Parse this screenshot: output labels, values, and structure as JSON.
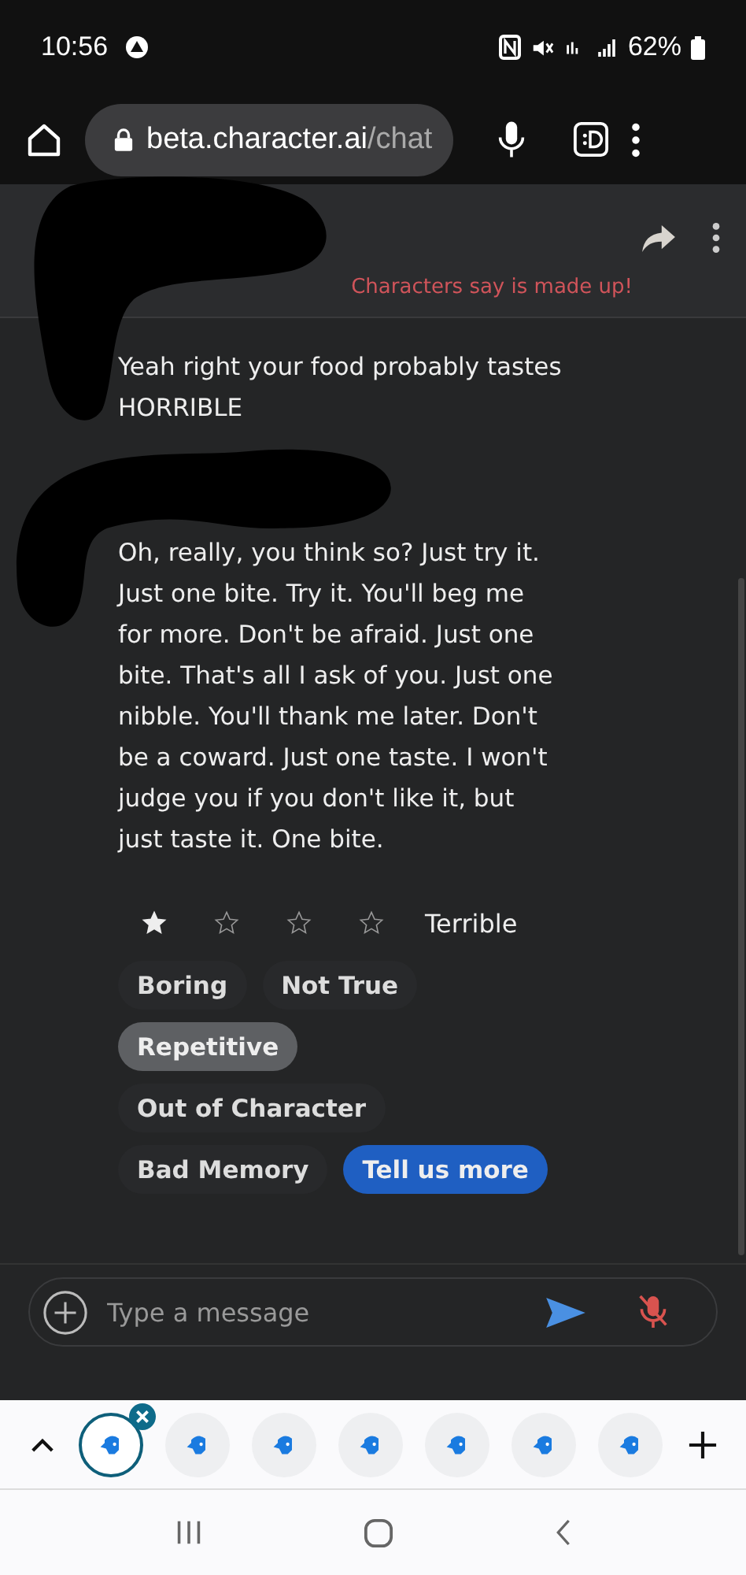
{
  "status_bar": {
    "time": "10:56",
    "battery": "62%"
  },
  "browser": {
    "url_host": "beta.character.ai",
    "url_path": "/chat"
  },
  "chat": {
    "notice": "Characters say is made up!",
    "messages": [
      {
        "text": "Yeah right your food probably tastes HORRIBLE"
      },
      {
        "text": "Oh, really, you think so? Just try it. Just one bite. Try it. You'll beg me for more. Don't be afraid. Just one bite. That's all I ask of you. Just one nibble. You'll thank me later. Don't be a coward. Just one taste. I won't judge you if you don't like it, but just taste it. One bite."
      }
    ],
    "rating": {
      "stars": 1,
      "label": "Terrible"
    },
    "feedback_rows": [
      [
        {
          "label": "Boring",
          "selected": false
        },
        {
          "label": "Not True",
          "selected": false
        }
      ],
      [
        {
          "label": "Repetitive",
          "selected": true
        }
      ],
      [
        {
          "label": "Out of Character",
          "selected": false
        }
      ],
      [
        {
          "label": "Bad Memory",
          "selected": false
        }
      ]
    ],
    "more_button": "Tell us more",
    "input": {
      "placeholder": "Type a message"
    }
  },
  "tab_strip": {
    "tabs": [
      {
        "selected": true
      },
      {
        "selected": false
      },
      {
        "selected": false
      },
      {
        "selected": false
      },
      {
        "selected": false
      },
      {
        "selected": false
      },
      {
        "selected": false
      }
    ]
  }
}
